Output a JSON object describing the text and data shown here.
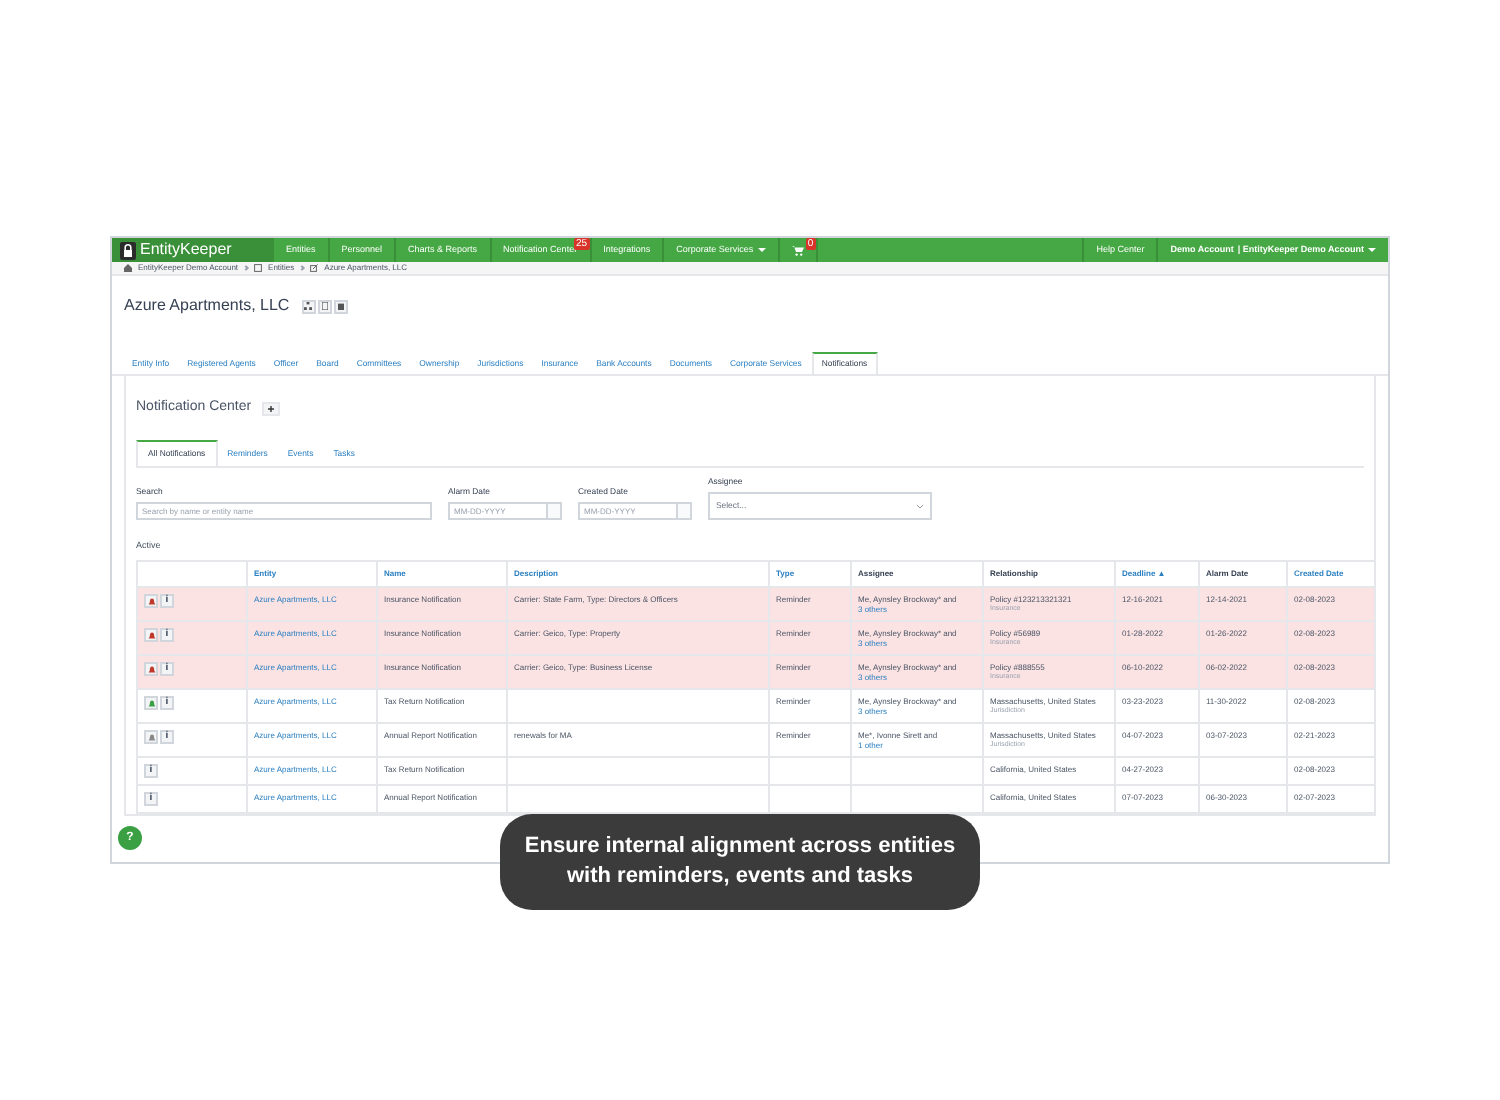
{
  "navbar": {
    "brand": "EntityKeeper",
    "items": [
      {
        "label": "Entities",
        "dropdown": false
      },
      {
        "label": "Personnel",
        "dropdown": false
      },
      {
        "label": "Charts & Reports",
        "dropdown": false
      },
      {
        "label": "Notification Center",
        "badge": "25",
        "dropdown": false
      },
      {
        "label": "Integrations",
        "dropdown": false
      },
      {
        "label": "Corporate Services",
        "dropdown": true
      }
    ],
    "cart_badge": "0",
    "help": "Help Center",
    "account": "Demo Account",
    "company": "| EntityKeeper Demo Account"
  },
  "breadcrumbs": [
    "EntityKeeper Demo Account",
    "Entities",
    "Azure Apartments, LLC"
  ],
  "entity_title": "Azure Apartments, LLC",
  "tabs": [
    {
      "label": "Entity Info",
      "selected": false
    },
    {
      "label": "Registered Agents",
      "selected": false
    },
    {
      "label": "Officer",
      "selected": false
    },
    {
      "label": "Board",
      "selected": false
    },
    {
      "label": "Committees",
      "selected": false
    },
    {
      "label": "Ownership",
      "selected": false
    },
    {
      "label": "Jurisdictions",
      "selected": false
    },
    {
      "label": "Insurance",
      "selected": false
    },
    {
      "label": "Bank Accounts",
      "selected": false
    },
    {
      "label": "Documents",
      "selected": false
    },
    {
      "label": "Corporate Services",
      "selected": false
    },
    {
      "label": "Notifications",
      "selected": true
    }
  ],
  "section_title": "Notification Center",
  "subtabs": [
    {
      "label": "All Notifications",
      "selected": true
    },
    {
      "label": "Reminders",
      "selected": false
    },
    {
      "label": "Events",
      "selected": false
    },
    {
      "label": "Tasks",
      "selected": false
    }
  ],
  "filters": {
    "search": {
      "label": "Search",
      "placeholder": "Search by name or entity name"
    },
    "alarm_date": {
      "label": "Alarm Date",
      "placeholder": "MM-DD-YYYY"
    },
    "created_date": {
      "label": "Created Date",
      "placeholder": "MM-DD-YYYY"
    },
    "assignee": {
      "label": "Assignee",
      "placeholder": "Select..."
    }
  },
  "active_label": "Active",
  "table": {
    "columns": [
      {
        "label": "Entity",
        "sortable": true
      },
      {
        "label": "Name",
        "sortable": true
      },
      {
        "label": "Description",
        "sortable": true
      },
      {
        "label": "Type",
        "sortable": true
      },
      {
        "label": "Assignee",
        "sortable": false
      },
      {
        "label": "Relationship",
        "sortable": false
      },
      {
        "label": "Deadline ▲",
        "sortable": true
      },
      {
        "label": "Alarm Date",
        "sortable": false
      },
      {
        "label": "Created Date",
        "sortable": true
      }
    ],
    "rows": [
      {
        "overdue": true,
        "color": "#c0392b",
        "info_button": "i",
        "entity": "Azure Apartments, LLC",
        "name": "Insurance Notification",
        "description": "Carrier: State Farm, Type: Directors & Officers",
        "type": "Reminder",
        "assignee": "Me, Aynsley Brockway* and",
        "assignee_link": "3 others",
        "relationship": "Policy #123213321321",
        "relationship_kind": "Insurance",
        "deadline": "12-16-2021",
        "alarm": "12-14-2021",
        "created": "02-08-2023"
      },
      {
        "overdue": true,
        "color": "#c0392b",
        "info_button": "i",
        "entity": "Azure Apartments, LLC",
        "name": "Insurance Notification",
        "description": "Carrier: Geico, Type: Property",
        "type": "Reminder",
        "assignee": "Me, Aynsley Brockway* and",
        "assignee_link": "3 others",
        "relationship": "Policy #56989",
        "relationship_kind": "Insurance",
        "deadline": "01-28-2022",
        "alarm": "01-26-2022",
        "created": "02-08-2023"
      },
      {
        "overdue": true,
        "color": "#c0392b",
        "info_button": "i",
        "entity": "Azure Apartments, LLC",
        "name": "Insurance Notification",
        "description": "Carrier: Geico, Type: Business License",
        "type": "Reminder",
        "assignee": "Me, Aynsley Brockway* and",
        "assignee_link": "3 others",
        "relationship": "Policy #888555",
        "relationship_kind": "Insurance",
        "deadline": "06-10-2022",
        "alarm": "06-02-2022",
        "created": "02-08-2023"
      },
      {
        "overdue": false,
        "color": "#3aa043",
        "info_button": "i",
        "entity": "Azure Apartments, LLC",
        "name": "Tax Return Notification",
        "description": "",
        "type": "Reminder",
        "assignee": "Me, Aynsley Brockway* and",
        "assignee_link": "3 others",
        "relationship": "Massachusetts, United States",
        "relationship_kind": "Jurisdiction",
        "deadline": "03-23-2023",
        "alarm": "11-30-2022",
        "created": "02-08-2023"
      },
      {
        "overdue": false,
        "color": "#888888",
        "info_button": "i",
        "entity": "Azure Apartments, LLC",
        "name": "Annual Report Notification",
        "description": "renewals for MA",
        "type": "Reminder",
        "assignee": "Me*, Ivonne Sirett and",
        "assignee_link": "1 other",
        "relationship": "Massachusetts, United States",
        "relationship_kind": "Jurisdiction",
        "deadline": "04-07-2023",
        "alarm": "03-07-2023",
        "created": "02-21-2023"
      },
      {
        "overdue": false,
        "info_button": "i",
        "entity": "Azure Apartments, LLC",
        "name": "Tax Return Notification",
        "relationship": "California, United States",
        "deadline": "04-27-2023",
        "created": "02-08-2023"
      },
      {
        "overdue": false,
        "info_button": "i",
        "entity": "Azure Apartments, LLC",
        "name": "Annual Report Notification",
        "relationship": "California, United States",
        "deadline": "07-07-2023",
        "alarm": "06-30-2023",
        "created": "02-07-2023"
      }
    ]
  },
  "help_button": "?",
  "caption": [
    "Ensure internal alignment across entities",
    "with reminders, events and tasks"
  ]
}
